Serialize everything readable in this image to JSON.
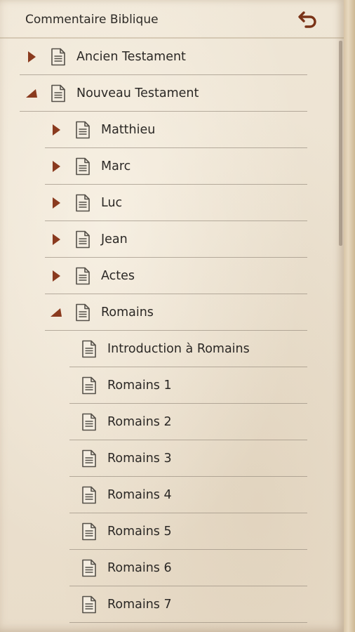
{
  "header": {
    "title": "Commentaire Biblique"
  },
  "items": [
    {
      "label": "Ancien Testament",
      "level": 0,
      "state": "collapsed"
    },
    {
      "label": "Nouveau Testament",
      "level": 0,
      "state": "expanded"
    },
    {
      "label": "Matthieu",
      "level": 1,
      "state": "collapsed"
    },
    {
      "label": "Marc",
      "level": 1,
      "state": "collapsed"
    },
    {
      "label": "Luc",
      "level": 1,
      "state": "collapsed"
    },
    {
      "label": "Jean",
      "level": 1,
      "state": "collapsed"
    },
    {
      "label": "Actes",
      "level": 1,
      "state": "collapsed"
    },
    {
      "label": "Romains",
      "level": 1,
      "state": "expanded"
    },
    {
      "label": "Introduction à Romains",
      "level": 2,
      "state": "leaf"
    },
    {
      "label": "Romains 1",
      "level": 2,
      "state": "leaf"
    },
    {
      "label": "Romains 2",
      "level": 2,
      "state": "leaf"
    },
    {
      "label": "Romains 3",
      "level": 2,
      "state": "leaf"
    },
    {
      "label": "Romains 4",
      "level": 2,
      "state": "leaf"
    },
    {
      "label": "Romains 5",
      "level": 2,
      "state": "leaf"
    },
    {
      "label": "Romains 6",
      "level": 2,
      "state": "leaf"
    },
    {
      "label": "Romains 7",
      "level": 2,
      "state": "leaf"
    }
  ],
  "colors": {
    "arrow": "#8a3a1e",
    "text": "#2b2825",
    "icon": "#555049"
  },
  "icons": {
    "back": "undo-arrow-icon",
    "collapsed": "triangle-right-icon",
    "expanded": "triangle-up-icon",
    "document": "document-icon"
  }
}
